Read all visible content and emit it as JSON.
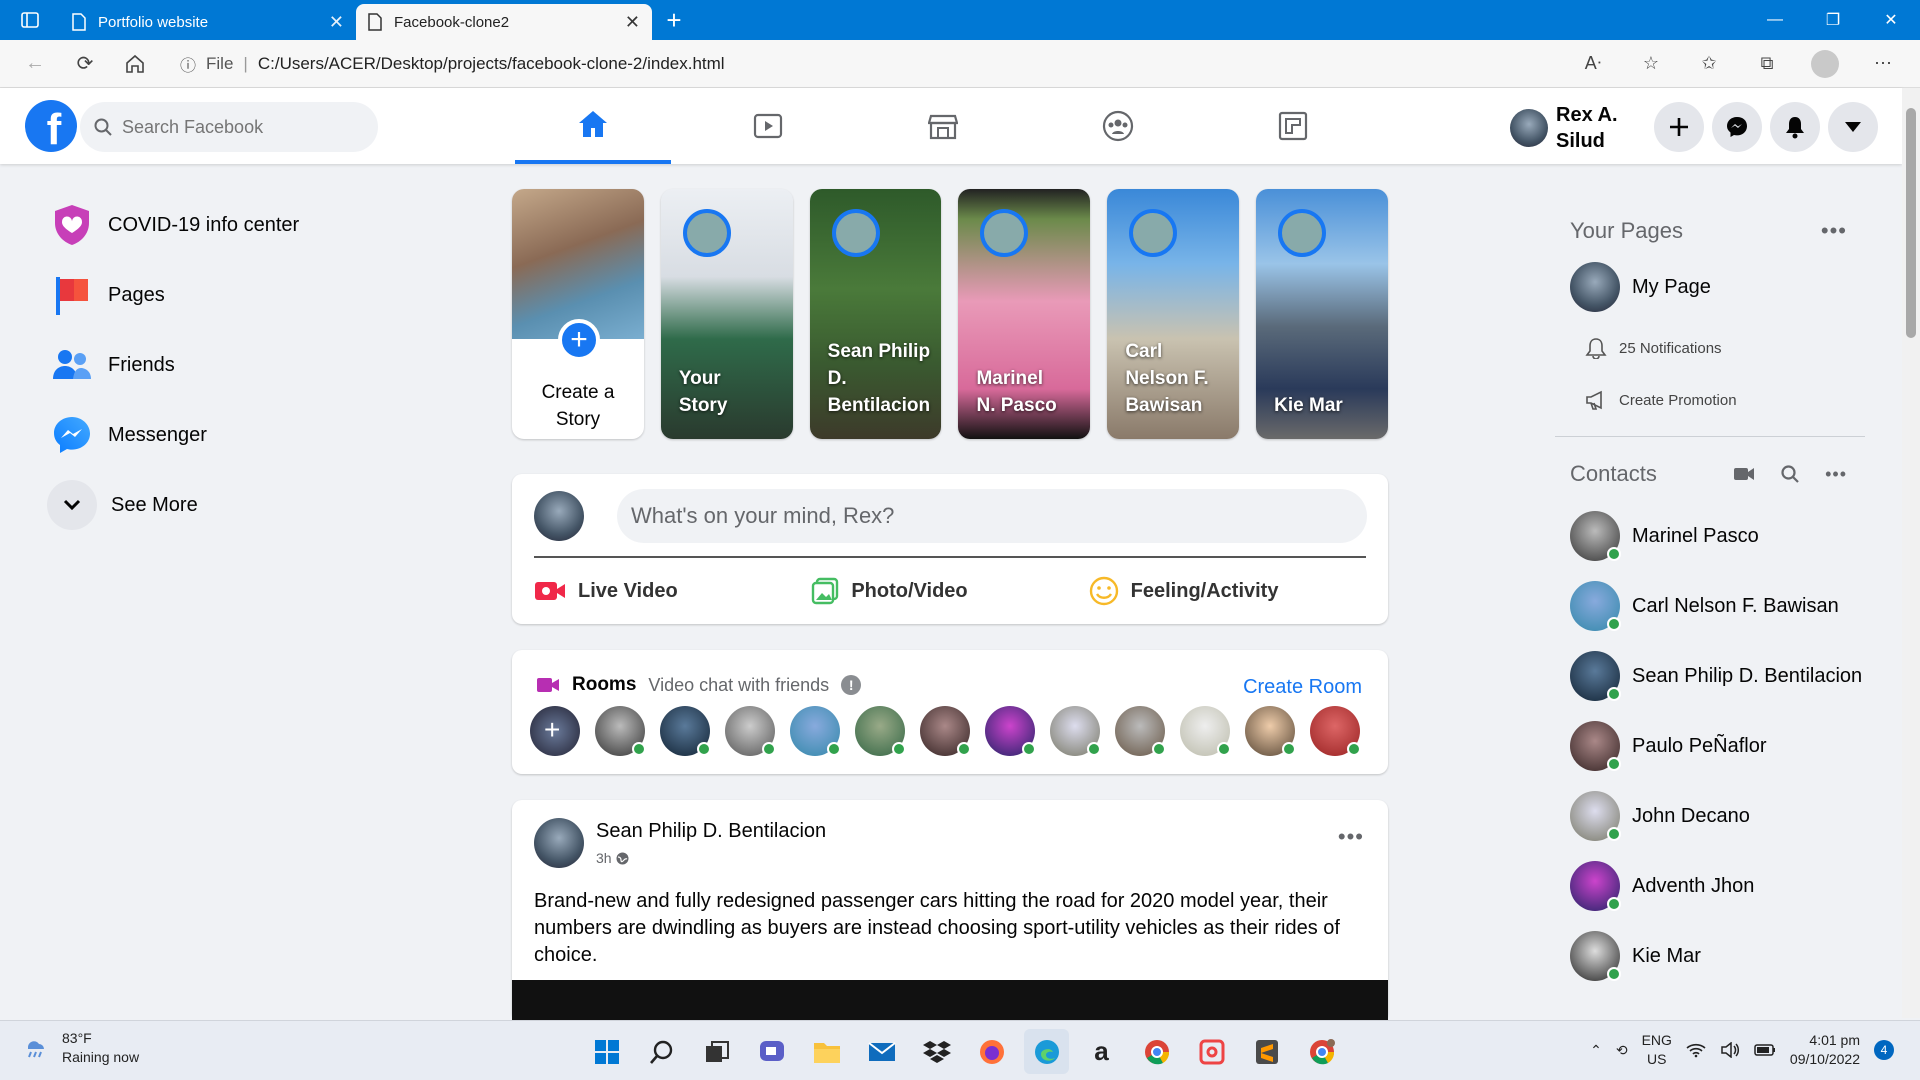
{
  "browser": {
    "tabs": [
      {
        "title": "Portfolio website"
      },
      {
        "title": "Facebook-clone2"
      }
    ],
    "address": {
      "scheme_label": "File",
      "url": "C:/Users/ACER/Desktop/projects/facebook-clone-2/index.html"
    }
  },
  "header": {
    "search_placeholder": "Search Facebook",
    "nav_tabs": [
      "home-icon",
      "watch-icon",
      "marketplace-icon",
      "groups-icon",
      "gaming-icon"
    ],
    "user_name_line1": "Rex A.",
    "user_name_line2": "Silud",
    "accent_color": "#1877f2"
  },
  "left_sidebar": {
    "items": [
      {
        "label": "COVID-19 info center",
        "icon": "covid-info-icon"
      },
      {
        "label": "Pages",
        "icon": "pages-flag-icon"
      },
      {
        "label": "Friends",
        "icon": "friends-icon"
      },
      {
        "label": "Messenger",
        "icon": "messenger-icon"
      },
      {
        "label": "See More",
        "icon": "chevron-down-icon"
      }
    ]
  },
  "stories": {
    "create_label_line1": "Create a",
    "create_label_line2": "Story",
    "items": [
      {
        "line1": "Your",
        "line2": "Story",
        "line3": ""
      },
      {
        "line1": "Sean Philip",
        "line2": "D.",
        "line3": "Bentilacion"
      },
      {
        "line1": "Marinel",
        "line2": "N. Pasco",
        "line3": ""
      },
      {
        "line1": "Carl",
        "line2": "Nelson F.",
        "line3": "Bawisan"
      },
      {
        "line1": "Kie Mar",
        "line2": "",
        "line3": ""
      }
    ]
  },
  "composer": {
    "placeholder": "What's on your mind, Rex?",
    "actions": [
      {
        "label": "Live Video",
        "icon": "live-video-icon",
        "color": "#f02849"
      },
      {
        "label": "Photo/Video",
        "icon": "photo-icon",
        "color": "#45bd62"
      },
      {
        "label": "Feeling/Activity",
        "icon": "feeling-icon",
        "color": "#f7b928"
      }
    ]
  },
  "rooms": {
    "title": "Rooms",
    "subtitle": "Video chat with friends",
    "create_label": "Create Room",
    "avatar_count": "13"
  },
  "post": {
    "author": "Sean Philip D. Bentilacion",
    "time": "3h",
    "text": "Brand-new and fully redesigned passenger cars hitting the road for 2020 model year, their numbers are dwindling as buyers are instead choosing sport-utility vehicles as their rides of choice."
  },
  "right_sidebar": {
    "pages_title": "Your Pages",
    "page_name": "My Page",
    "notifications": "25 Notifications",
    "promotion": "Create Promotion",
    "contacts_title": "Contacts",
    "contacts": [
      {
        "name": "Marinel Pasco"
      },
      {
        "name": "Carl Nelson F. Bawisan"
      },
      {
        "name": "Sean Philip D. Bentilacion"
      },
      {
        "name": "Paulo PeÑaflor"
      },
      {
        "name": "John Decano"
      },
      {
        "name": "Adventh Jhon"
      },
      {
        "name": "Kie Mar"
      }
    ]
  },
  "taskbar": {
    "temperature": "83°F",
    "weather": "Raining now",
    "lang_line1": "ENG",
    "lang_line2": "US",
    "time": "4:01 pm",
    "date": "09/10/2022",
    "notification_count": "4"
  }
}
